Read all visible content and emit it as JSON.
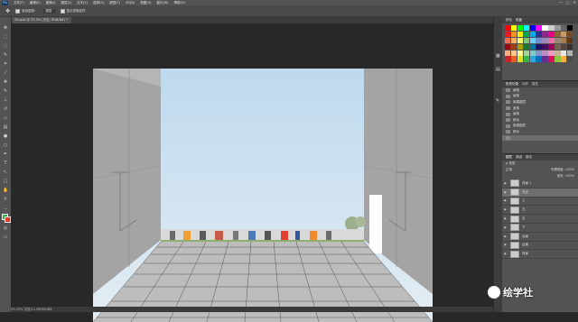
{
  "app": {
    "logo": "Ps"
  },
  "menu": [
    "文件(F)",
    "编辑(E)",
    "图像(I)",
    "图层(L)",
    "文字(Y)",
    "选择(S)",
    "滤镜(T)",
    "3D(D)",
    "视图(V)",
    "窗口(W)",
    "帮助(H)"
  ],
  "window_buttons": [
    "—",
    "□",
    "✕"
  ],
  "options": {
    "auto_select": "自动选择：",
    "target": "图层",
    "transform": "显示变换控件"
  },
  "document_tab": "3D.psd @ 33.3% (天空, RGB/8#) *",
  "status": "33.33%    文档:11.0M/59.6M",
  "panels": {
    "swatches_tabs": [
      "颜色",
      "色板"
    ],
    "history_tabs": [
      "历史记录",
      "动作",
      "属性"
    ],
    "history_items": [
      "画笔",
      "画笔",
      "新建图层",
      "画笔",
      "画笔",
      "移动",
      "新建图层",
      "移动",
      ""
    ],
    "layers_tabs": [
      "图层",
      "通道",
      "路径"
    ],
    "layers_kind": "ρ 类型",
    "layers_mode": "正常",
    "layers_opacity": "不透明度: 100%",
    "layers_fill": "填充: 100%",
    "layers": [
      "背景 1",
      "天空",
      "上",
      "左",
      "右",
      "下",
      "远景",
      "近景",
      "背景"
    ]
  },
  "swatch_colors": [
    "#ff0000",
    "#ffff00",
    "#00ff00",
    "#00ffff",
    "#0000ff",
    "#ff00ff",
    "#ffffff",
    "#cccccc",
    "#999999",
    "#666666",
    "#000000",
    "#ed1c24",
    "#f7941d",
    "#fff200",
    "#00a651",
    "#00aeef",
    "#2e3192",
    "#92278f",
    "#ec008c",
    "#8c6239",
    "#c69c6d",
    "#754c24",
    "#f26c4f",
    "#fbaf5d",
    "#fff568",
    "#7cc576",
    "#6dcff6",
    "#6e8ccf",
    "#a186be",
    "#f06eaa",
    "#998675",
    "#a67c52",
    "#603913",
    "#9e0b0f",
    "#a0410d",
    "#aba000",
    "#197b30",
    "#0076a3",
    "#1b1464",
    "#440e62",
    "#9e005d",
    "#736357",
    "#534741",
    "#362f2d",
    "#f9ad81",
    "#fdc68a",
    "#fff799",
    "#a3d39c",
    "#7accc8",
    "#8493ca",
    "#bc8dbf",
    "#f49ac2",
    "#c7b299",
    "#e6e6e6",
    "#b3b3b3",
    "#c1272d",
    "#f15a24",
    "#d9e021",
    "#39b54a",
    "#29abe2",
    "#0071bc",
    "#662d91",
    "#d4145a",
    "#8cc63f",
    "#fbb03b",
    "#4d4d4d"
  ],
  "watermark": "绘学社",
  "colors": {
    "accent": "#27b24a",
    "background": "#e03a2f"
  }
}
